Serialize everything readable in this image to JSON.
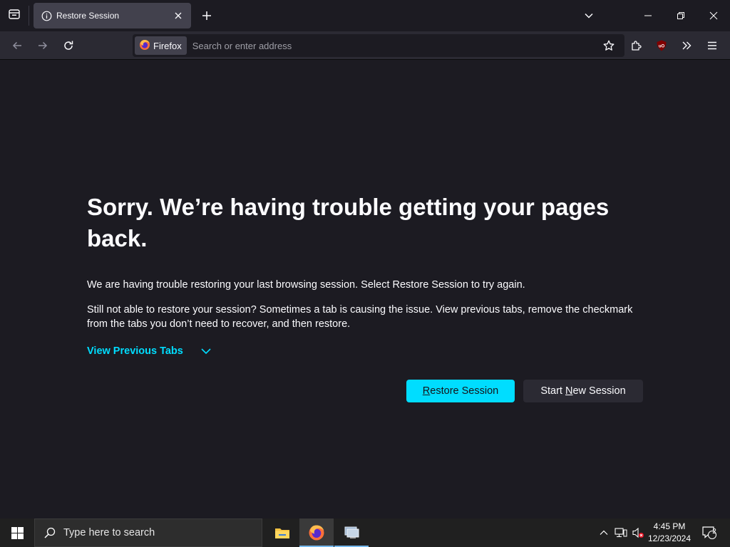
{
  "browser": {
    "tab": {
      "title": "Restore Session"
    },
    "urlbar": {
      "identity_label": "Firefox",
      "placeholder": "Search or enter address"
    }
  },
  "page": {
    "heading": "Sorry. We’re having trouble getting your pages back.",
    "paragraph1": "We are having trouble restoring your last browsing session. Select Restore Session to try again.",
    "paragraph2": "Still not able to restore your session? Sometimes a tab is causing the issue. View previous tabs, remove the checkmark from the tabs you don’t need to recover, and then restore.",
    "view_tabs_label": "View Previous Tabs",
    "restore_button": {
      "accel": "R",
      "rest": "estore Session"
    },
    "new_session_button": {
      "before": "Start ",
      "accel": "N",
      "rest": "ew Session"
    }
  },
  "taskbar": {
    "search_placeholder": "Type here to search",
    "time": "4:45 PM",
    "date": "12/23/2024",
    "notification_count": "2"
  },
  "icons": [
    "tab-list-icon",
    "info-icon",
    "close-tab-icon",
    "new-tab-icon",
    "list-all-tabs-icon",
    "minimize-icon",
    "restore-icon",
    "close-window-icon",
    "back-icon",
    "forward-icon",
    "reload-icon",
    "firefox-logo-icon",
    "bookmark-star-icon",
    "extensions-icon",
    "ublock-origin-icon",
    "overflow-chevrons-icon",
    "menu-icon",
    "chevron-down-icon",
    "windows-start-icon",
    "search-icon",
    "file-explorer-icon",
    "firefox-taskbar-icon",
    "network-app-icon",
    "show-hidden-icons-chevron",
    "network-icon",
    "volume-muted-icon",
    "notification-icon"
  ],
  "colors": {
    "background": "#1c1b22",
    "toolbar": "#2b2a33",
    "accent": "#00ddff",
    "text": "#fbfbfe",
    "taskbar": "#202020"
  }
}
